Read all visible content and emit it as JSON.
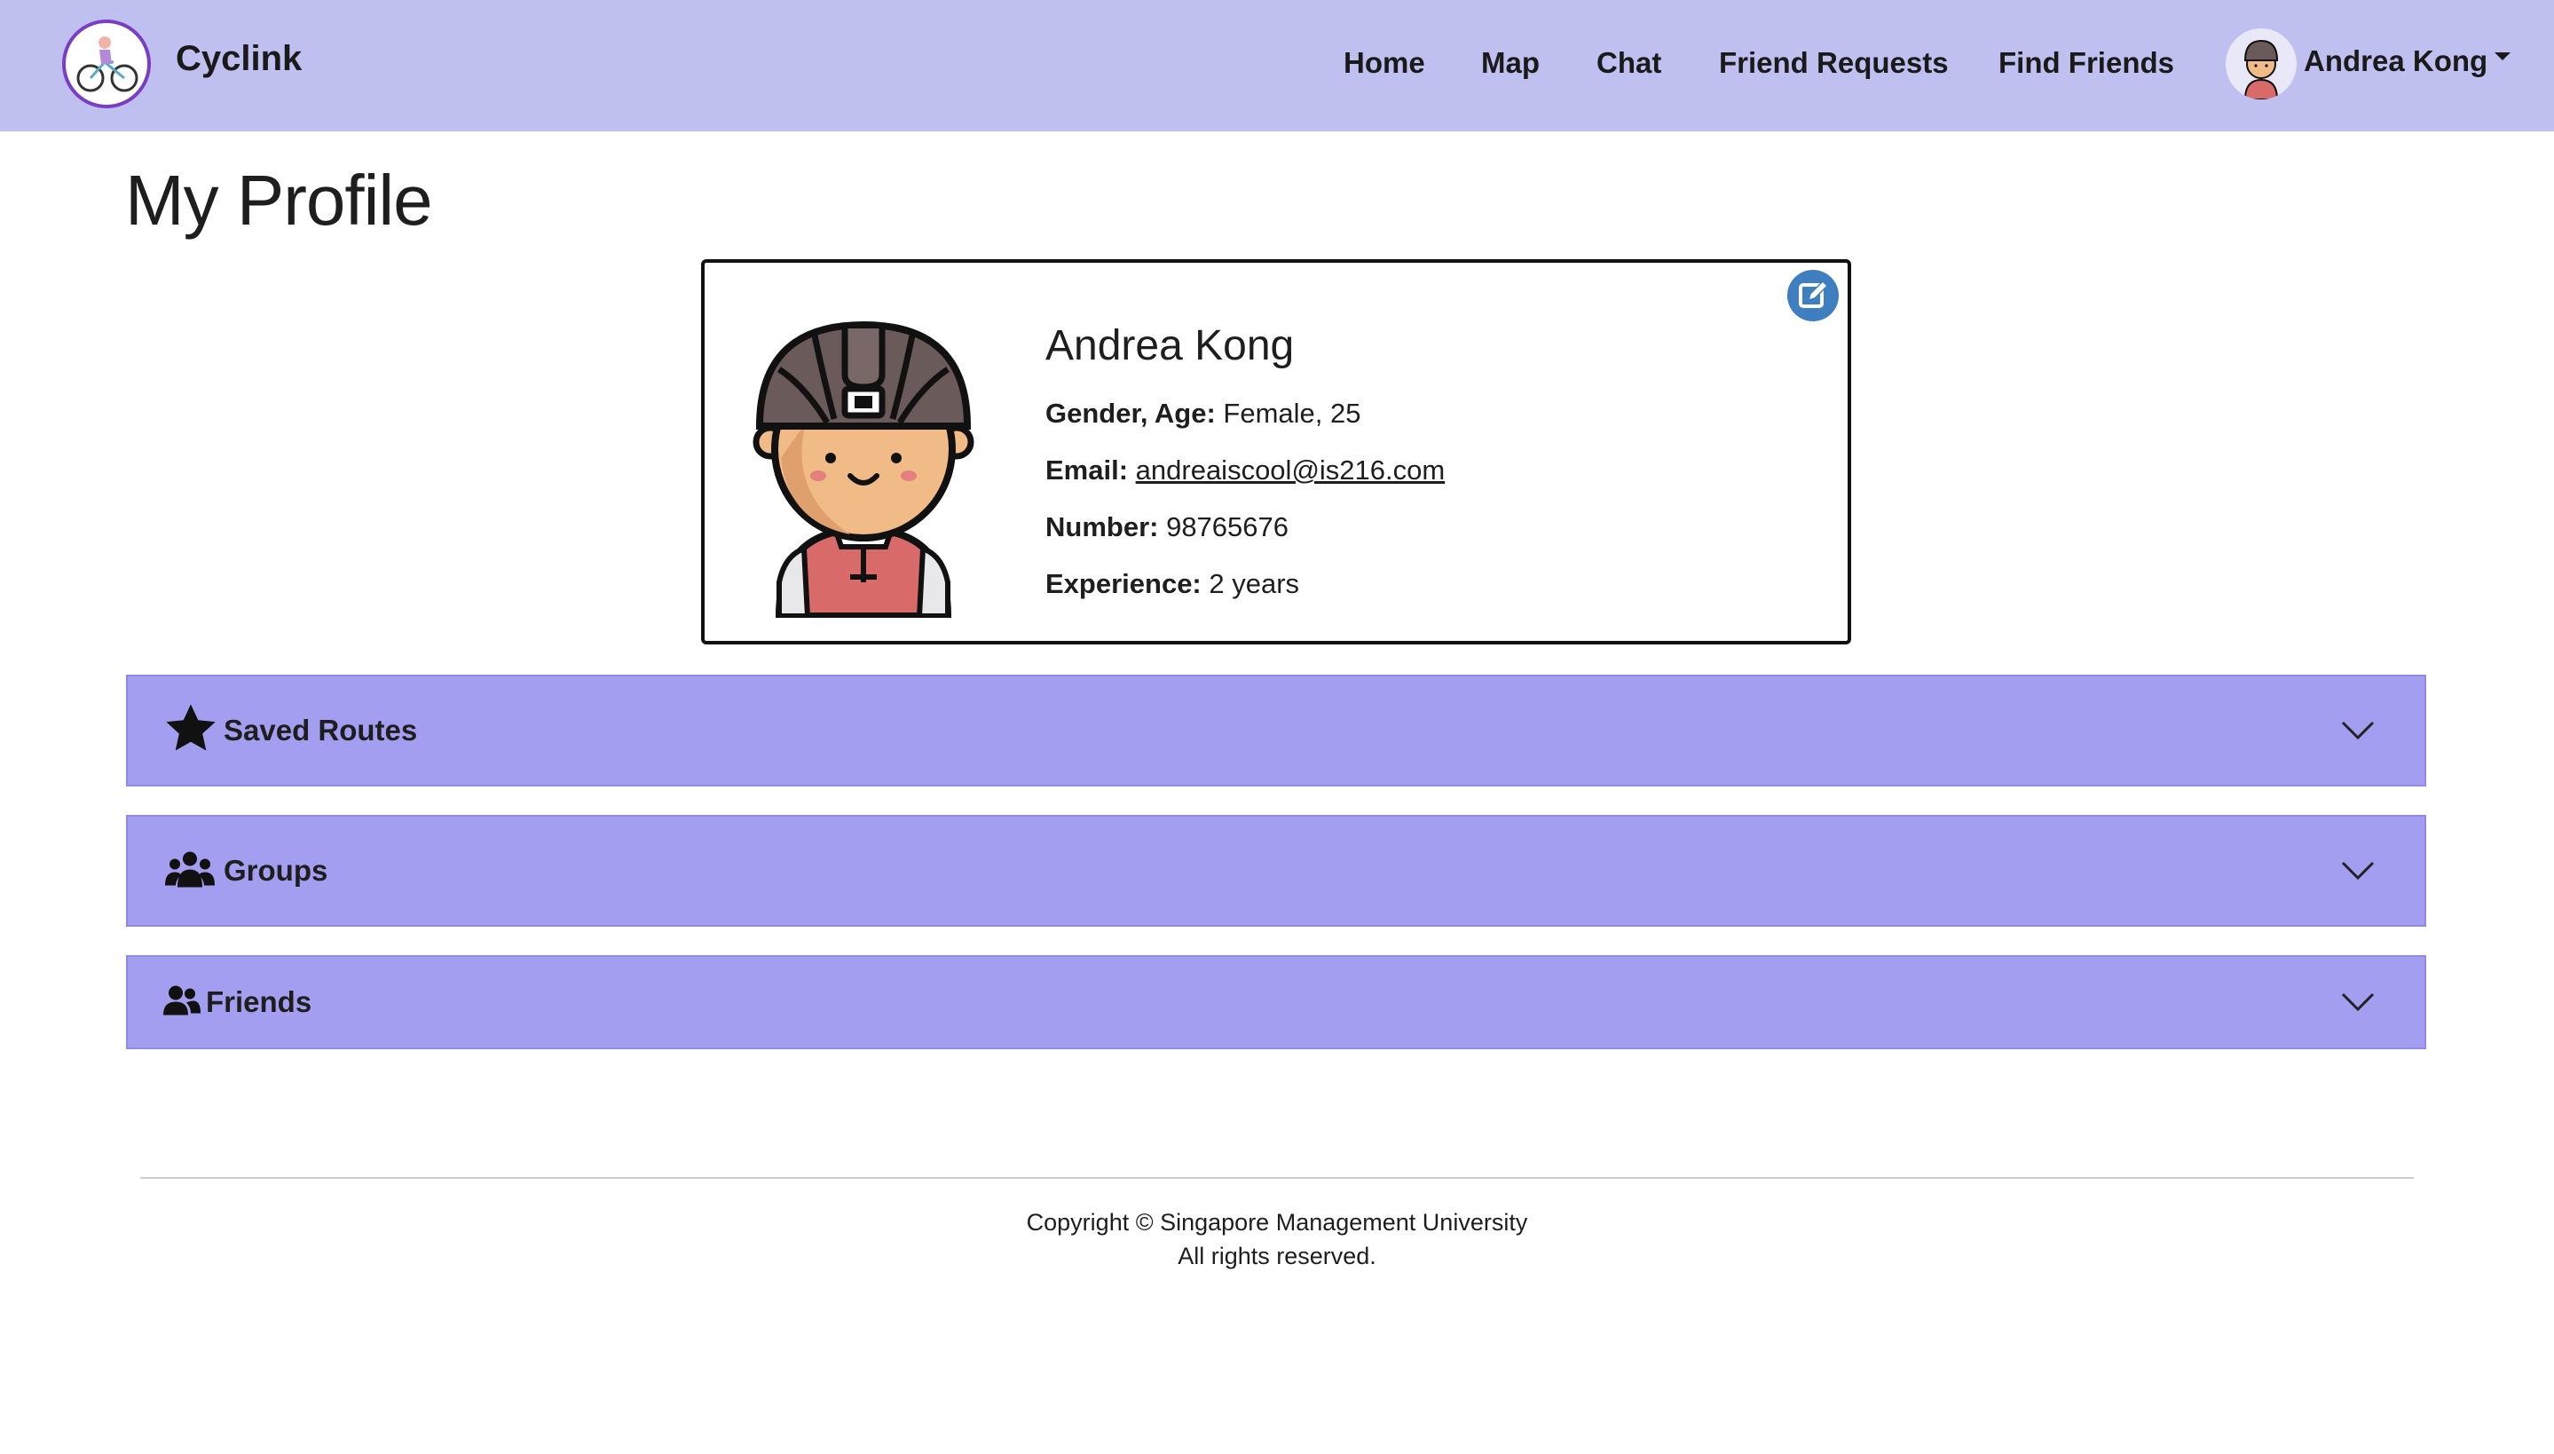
{
  "brand": {
    "name": "Cyclink",
    "logo_icon": "bicycle-logo-icon"
  },
  "nav": {
    "home": "Home",
    "map": "Map",
    "chat": "Chat",
    "friend_requests": "Friend Requests",
    "find_friends": "Find Friends",
    "user_name": "Andrea Kong"
  },
  "page": {
    "title": "My Profile"
  },
  "profile": {
    "name": "Andrea Kong",
    "gender_age_label": "Gender, Age:",
    "gender_age_value": "Female, 25",
    "email_label": "Email:",
    "email_value": "andreaiscool@is216.com",
    "number_label": "Number:",
    "number_value": "98765676",
    "experience_label": "Experience:",
    "experience_value": "2 years",
    "edit_icon": "edit-icon"
  },
  "sections": {
    "saved_routes": "Saved Routes",
    "groups": "Groups",
    "friends": "Friends"
  },
  "footer": {
    "copyright": "Copyright © Singapore Management University",
    "rights": "All rights reserved."
  },
  "colors": {
    "navbar": "#bfbff0",
    "accordion": "#a39ef0",
    "edit_button": "#3f7fc0",
    "logo_ring": "#7a3fc0"
  }
}
